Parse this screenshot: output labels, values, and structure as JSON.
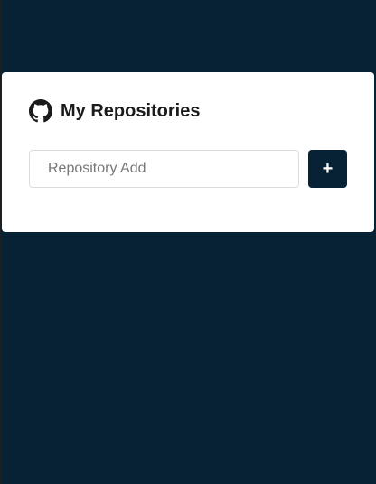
{
  "card": {
    "title": "My Repositories",
    "title_icon": "github-icon"
  },
  "form": {
    "input_placeholder": "Repository Add",
    "input_value": "",
    "add_button_label": "+"
  },
  "colors": {
    "background": "#062234",
    "card": "#ffffff",
    "button": "#062234"
  }
}
